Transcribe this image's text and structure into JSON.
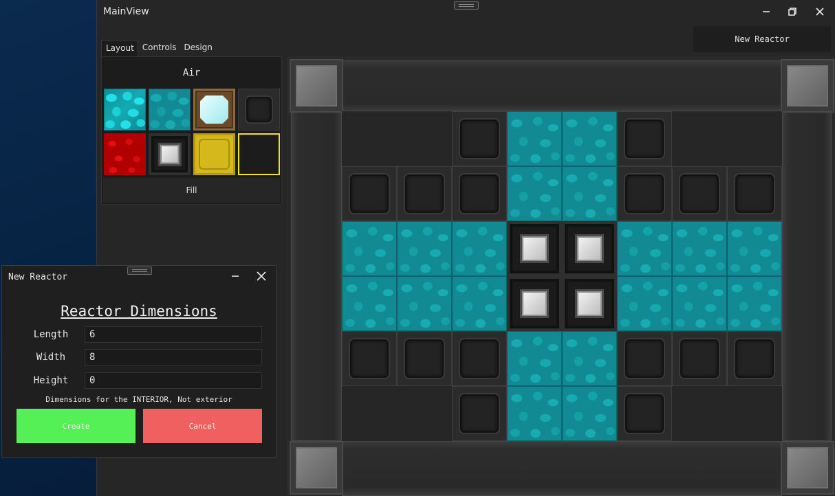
{
  "main_window": {
    "title": "MainView",
    "new_reactor_label": "New Reactor"
  },
  "palette": {
    "tabs": [
      "Layout",
      "Controls",
      "Design"
    ],
    "active_tab": "Layout",
    "selected_block": "Air",
    "fill_label": "Fill",
    "blocks": [
      "coolant",
      "coolant-dark",
      "glass",
      "casing",
      "redstone",
      "fuel-rod",
      "yellow",
      "air"
    ]
  },
  "dialog": {
    "title": "New Reactor",
    "heading": "Reactor Dimensions",
    "fields": [
      {
        "label": "Length",
        "value": "6"
      },
      {
        "label": "Width",
        "value": "8"
      },
      {
        "label": "Height",
        "value": "0"
      }
    ],
    "note": "Dimensions for the INTERIOR, Not exterior",
    "create_label": "Create",
    "cancel_label": "Cancel",
    "create_color": "#55f055",
    "cancel_color": "#f06060"
  },
  "reactor_grid": {
    "rows": [
      [
        "empty",
        "empty",
        "casing",
        "coolant",
        "coolant",
        "casing",
        "empty",
        "empty"
      ],
      [
        "casing",
        "casing",
        "casing",
        "coolant",
        "coolant",
        "casing",
        "casing",
        "casing"
      ],
      [
        "coolant",
        "coolant",
        "coolant",
        "fuel-rod",
        "fuel-rod",
        "coolant",
        "coolant",
        "coolant"
      ],
      [
        "coolant",
        "coolant",
        "coolant",
        "fuel-rod",
        "fuel-rod",
        "coolant",
        "coolant",
        "coolant"
      ],
      [
        "casing",
        "casing",
        "casing",
        "coolant",
        "coolant",
        "casing",
        "casing",
        "casing"
      ],
      [
        "empty",
        "empty",
        "casing",
        "coolant",
        "coolant",
        "casing",
        "empty",
        "empty"
      ]
    ]
  }
}
